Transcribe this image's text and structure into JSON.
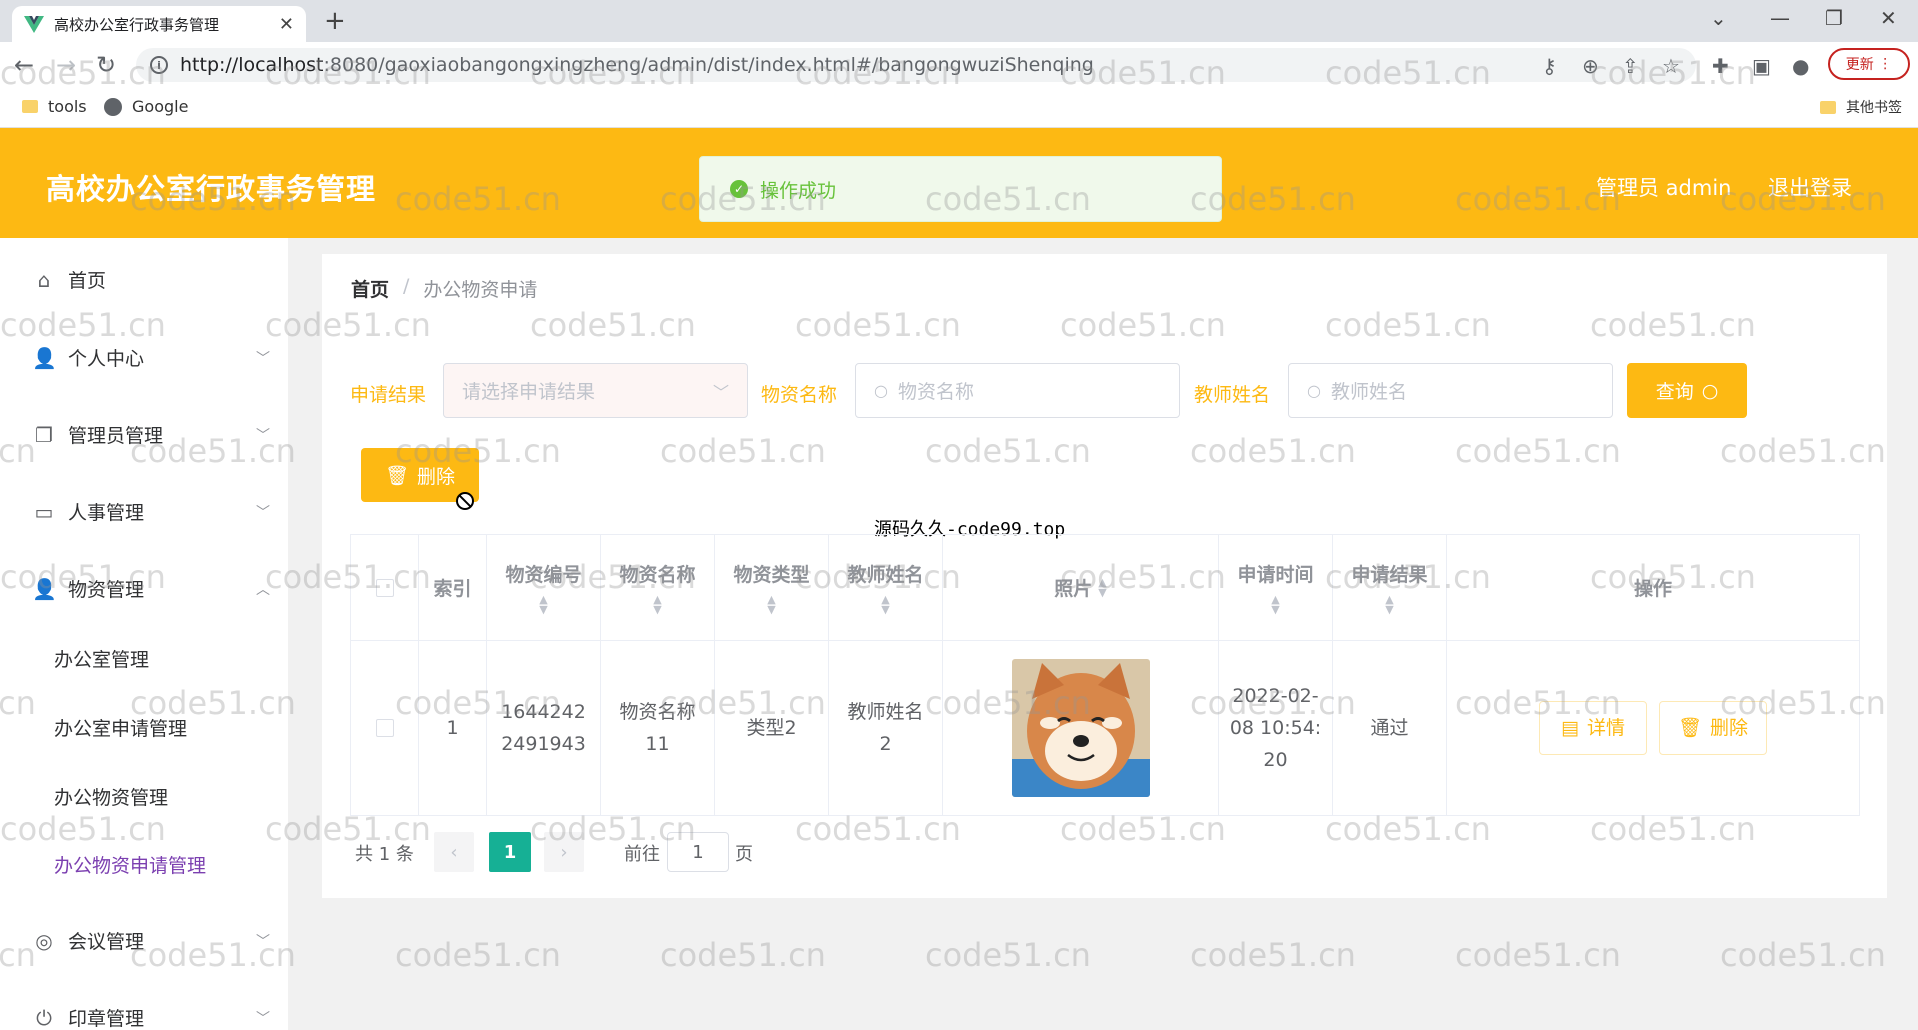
{
  "browser": {
    "tab_title": "高校办公室行政事务管理",
    "url_host": "http://localhost",
    "url_rest": ":8080/gaoxiaobangongxingzheng/admin/dist/index.html#/bangongwuziShenqing",
    "update_label": "更新",
    "bookmarks": [
      "tools",
      "Google"
    ],
    "other_bookmarks": "其他书签"
  },
  "header": {
    "title": "高校办公室行政事务管理",
    "user": "管理员 admin",
    "logout": "退出登录"
  },
  "toast": {
    "message": "操作成功"
  },
  "sidebar": {
    "items": [
      {
        "label": "首页",
        "icon": "home-icon"
      },
      {
        "label": "个人中心",
        "icon": "user-icon"
      },
      {
        "label": "管理员管理",
        "icon": "copy-icon"
      },
      {
        "label": "人事管理",
        "icon": "chat-icon"
      },
      {
        "label": "物资管理",
        "icon": "user-icon"
      },
      {
        "label": "会议管理",
        "icon": "compass-icon"
      },
      {
        "label": "印章管理",
        "icon": "power-icon"
      }
    ],
    "subitems": [
      "办公室管理",
      "办公室申请管理",
      "办公物资管理",
      "办公物资申请管理"
    ]
  },
  "breadcrumb": {
    "home": "首页",
    "sep": "/",
    "current": "办公物资申请"
  },
  "filters": {
    "result_label": "申请结果",
    "result_placeholder": "请选择申请结果",
    "name_label": "物资名称",
    "name_placeholder": "物资名称",
    "teacher_label": "教师姓名",
    "teacher_placeholder": "教师姓名",
    "query_label": "查询"
  },
  "delete_label": "删除",
  "overlay_text": "源码久久-code99.top",
  "table": {
    "headers": [
      "索引",
      "物资编号",
      "物资名称",
      "物资类型",
      "教师姓名",
      "照片",
      "申请时间",
      "申请结果",
      "操作"
    ],
    "rows": [
      {
        "index": "1",
        "code_1": "1644242",
        "code_2": "2491943",
        "name_1": "物资名称",
        "name_2": "11",
        "type": "类型2",
        "teacher_1": "教师姓名",
        "teacher_2": "2",
        "time_1": "2022-02-",
        "time_2": "08 10:54:",
        "time_3": "20",
        "result": "通过",
        "detail_label": "详情",
        "delete_label": "删除"
      }
    ]
  },
  "pagination": {
    "total": "共 1 条",
    "current": "1",
    "goto_prefix": "前往",
    "goto_value": "1",
    "goto_suffix": "页"
  },
  "watermark": "code51.cn",
  "colors": {
    "accent": "#fdb913",
    "success": "#67c23a",
    "page_active": "#16b095",
    "submenu_active": "#7b3fb0"
  }
}
